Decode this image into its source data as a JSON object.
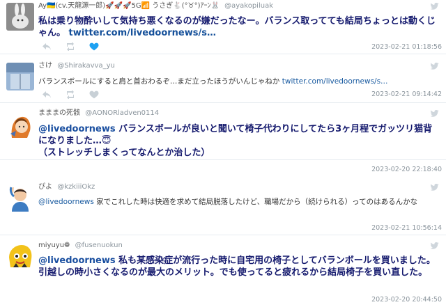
{
  "tweets": [
    {
      "name": "Ay🇺🇦(cv.天龍源一郎)🚀🚀🚀5G📶 うさぎ🐇(°♉°)ｱｰﾝ🐰",
      "handle": "@ayakopiluak",
      "text": "私は乗り物酔いして気持ち悪くなるのが嫌だったなー。バランス取ってても結局ちょっとは動くじゃん。",
      "link": "twitter.com/livedoornews/s…",
      "time": "2023-02-21 01:18:56",
      "liked": true
    },
    {
      "name": "さけ",
      "handle": "@Shirakavva_yu",
      "text": "バランスボールにすると肩と首おわるぞ…まだ立ったほうがいんじゃねか",
      "link": "twitter.com/livedoornews/s…",
      "time": "2023-02-21 09:14:42",
      "liked": false
    },
    {
      "name": "まままの死骸",
      "handle": "@AONORladven0114",
      "mention": "@livedoornews",
      "text": " バランスボールが良いと聞いて椅子代わりにしてたら3ヶ月程でガッツリ猫背になりました…😇",
      "text2": "（ストレッチしまくってなんとか治した）",
      "time": "2023-02-20 22:18:40",
      "liked": false
    },
    {
      "name": "ぴよ",
      "handle": "@kzkiiiOkz",
      "mention": "@livedoornews",
      "text": " 家でこれした時は快適を求めて結局脱落したけど、職場だから（続けられる）ってのはあるんかな",
      "time": "2023-02-21 10:56:14",
      "liked": false
    },
    {
      "name": "miyuyu❁",
      "handle": "@fusenuokun",
      "mention": "@livedoornews",
      "text": " 私も某感染症が流行った時に自宅用の椅子としてバランボールを買いました。引越しの時小さくなるのが最大のメリット。でも使ってると疲れるから結局椅子を買い直した。",
      "time": "2023-02-20 20:44:50",
      "liked": false
    }
  ],
  "colors": {
    "accent_link": "#1a5ba0",
    "liked_heart": "#1da1f2",
    "big_text": "#151a6e"
  }
}
